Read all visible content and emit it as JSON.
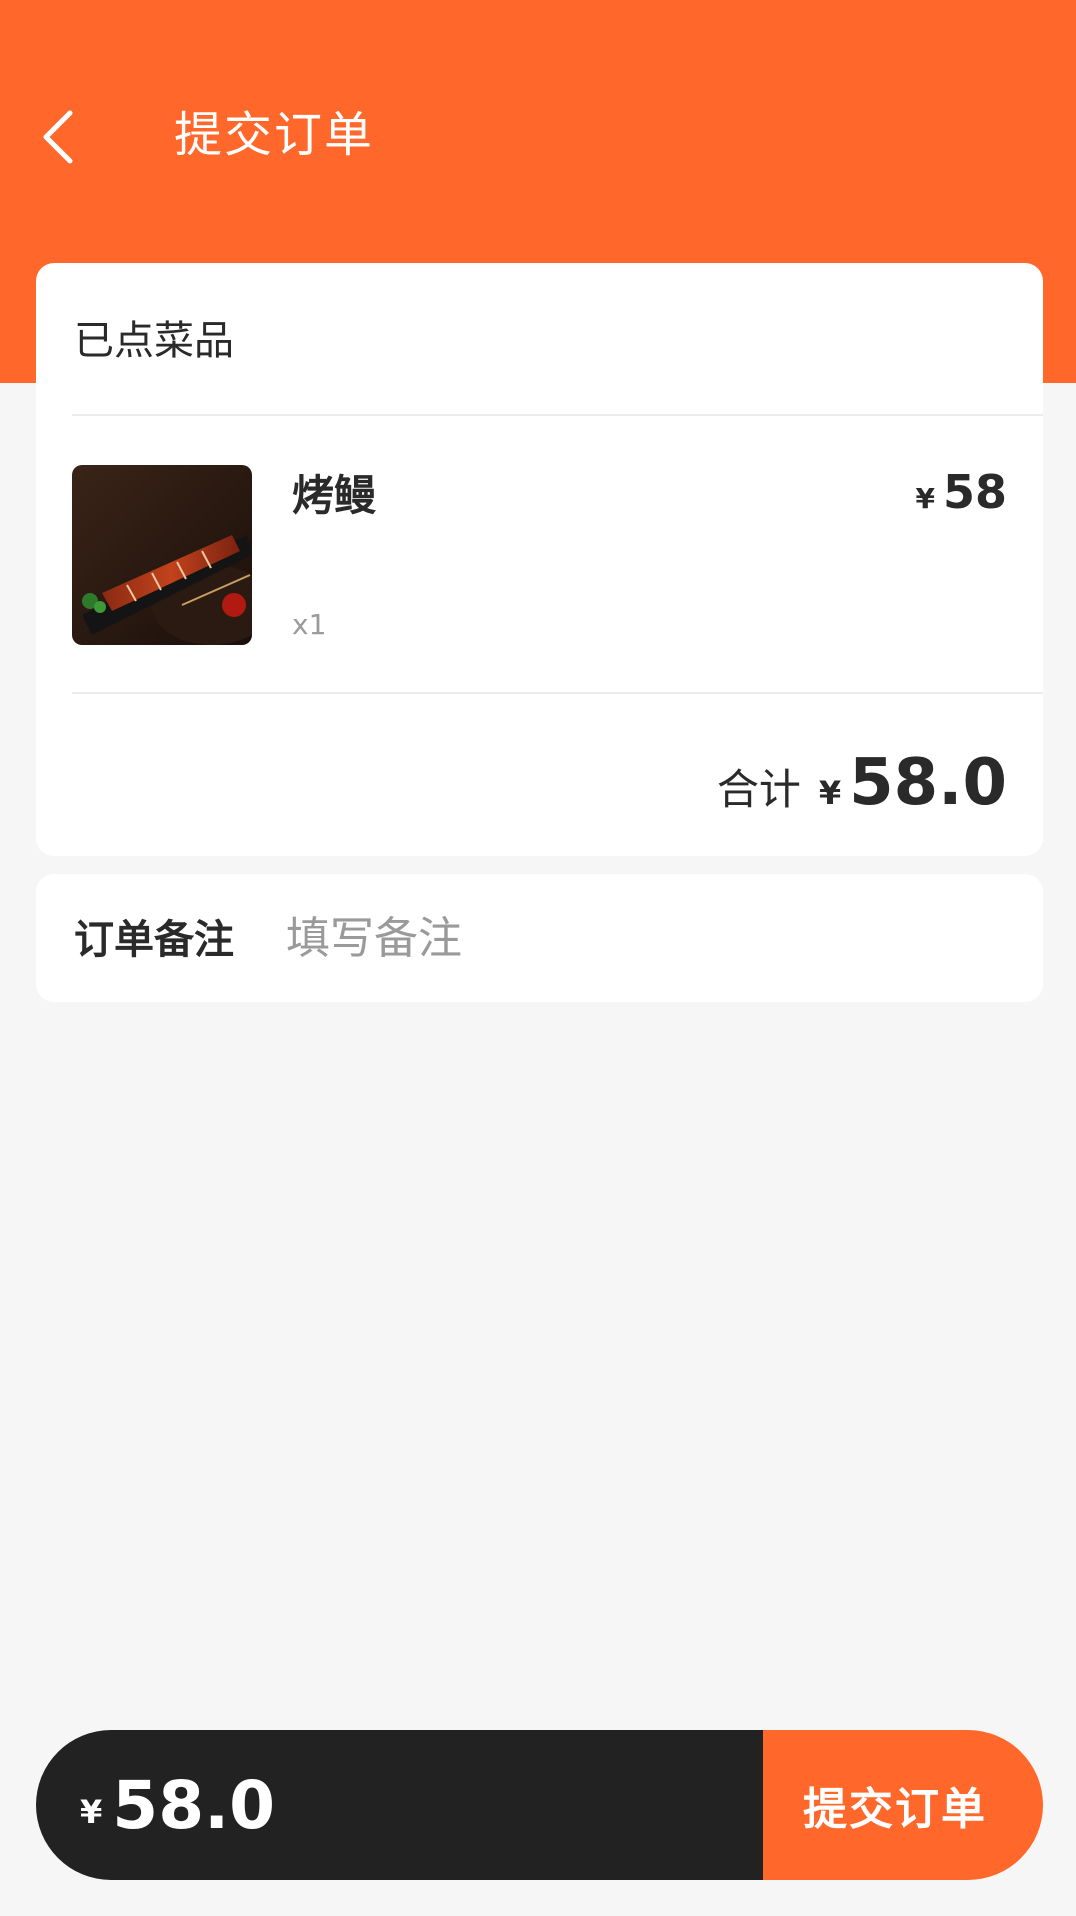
{
  "header": {
    "title": "提交订单",
    "back_icon": "chevron-left-icon",
    "background_color": "#ff672b"
  },
  "order": {
    "section_title": "已点菜品",
    "items": [
      {
        "name": "烤鳗",
        "quantity": "x1",
        "currency": "¥",
        "price": "58",
        "image_icon": "grilled-eel-thumbnail"
      }
    ],
    "total_label": "合计",
    "total_currency": "¥",
    "total_amount": "58.0"
  },
  "notes": {
    "label": "订单备注",
    "placeholder": "填写备注",
    "value": ""
  },
  "footer": {
    "currency": "¥",
    "amount": "58.0",
    "submit_label": "提交订单",
    "bar_color": "#222222",
    "accent_color": "#ff672b"
  }
}
